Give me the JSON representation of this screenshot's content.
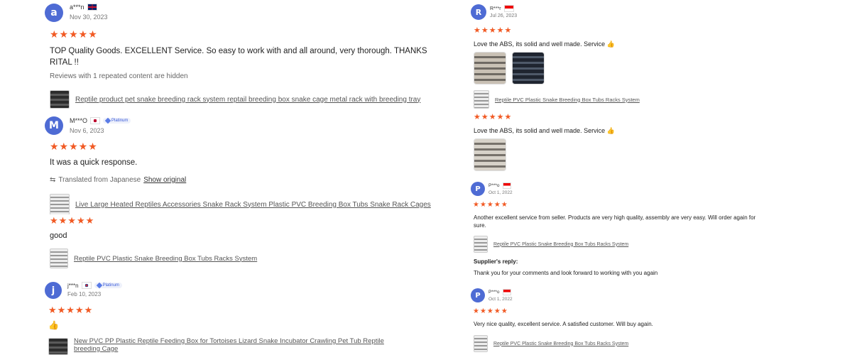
{
  "left": {
    "reviews": [
      {
        "initial": "a",
        "name": "a***n",
        "date": "Nov 30, 2023",
        "stars": "★★★★★",
        "text": "TOP Quality Goods. EXCELLENT Service. So easy to work with and all around, very thorough. THANKS RITAL !!",
        "note": "Reviews with 1 repeated content are hidden",
        "product": "Reptile product pet snake breeding rack system reptail breeding box snake cage metal rack with breeding tray"
      },
      {
        "initial": "M",
        "name": "M***O",
        "badge": "Platinum",
        "date": "Nov 6, 2023",
        "stars": "★★★★★",
        "text": "It was a quick response.",
        "translated": "Translated from Japanese",
        "show_original": "Show original",
        "product": "Live Large Heated Reptiles Accessories Snake Rack System Plastic PVC Breeding Box Tubs Snake Rack Cages"
      },
      {
        "stars": "★★★★★",
        "text": "good",
        "product": "Reptile PVC Plastic Snake Breeding Box Tubs Racks System"
      },
      {
        "initial": "j",
        "name": "j***n",
        "badge": "Platinum",
        "date": "Feb 10, 2023",
        "stars": "★★★★★",
        "text": "👍",
        "product": "New PVC PP Plastic Reptile Feeding Box for Tortoises Lizard Snake Incubator Crawling Pet Tub Reptile breeding Cage"
      }
    ]
  },
  "right": {
    "reviews": [
      {
        "initial": "R",
        "name": "R***r",
        "date": "Jul 26, 2023",
        "stars": "★★★★★",
        "text": "Love the ABS, its solid and well made. Service 👍",
        "product": "Reptile PVC Plastic Snake Breeding Box Tubs Racks System"
      },
      {
        "stars": "★★★★★",
        "text": "Love the ABS, its solid and well made. Service 👍"
      },
      {
        "initial": "P",
        "name": "P***o",
        "date": "Oct 1, 2022",
        "stars": "★★★★★",
        "text": "Another excellent service from seller. Products are very high quality, assembly are very easy. Will order again for sure.",
        "product": "Reptile PVC Plastic Snake Breeding Box Tubs Racks System",
        "supplier_label": "Supplier's reply:",
        "supplier_reply": "Thank you for your comments and look forward to working with you again"
      },
      {
        "initial": "P",
        "name": "P***o",
        "date": "Oct 1, 2022",
        "stars": "★★★★★",
        "text": "Very nice quality, excellent service. A satisfied customer. Will buy again.",
        "product": "Reptile PVC Plastic Snake Breeding Box Tubs Racks System"
      }
    ]
  }
}
